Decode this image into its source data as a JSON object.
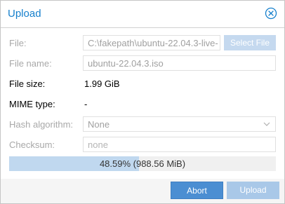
{
  "dialog": {
    "title": "Upload"
  },
  "form": {
    "file": {
      "label": "File:",
      "value": "C:\\fakepath\\ubuntu-22.04.3-live-",
      "button": "Select File"
    },
    "file_name": {
      "label": "File name:",
      "value": "ubuntu-22.04.3.iso"
    },
    "file_size": {
      "label": "File size:",
      "value": "1.99 GiB"
    },
    "mime_type": {
      "label": "MIME type:",
      "value": "-"
    },
    "hash_algorithm": {
      "label": "Hash algorithm:",
      "value": "None"
    },
    "checksum": {
      "label": "Checksum:",
      "placeholder": "none"
    }
  },
  "progress": {
    "fraction": 0.4859,
    "text": "48.59% (988.56 MiB)"
  },
  "buttons": {
    "abort": "Abort",
    "upload": "Upload"
  },
  "icons": {
    "close": "close-circle-icon",
    "dropdown": "chevron-down-icon"
  },
  "colors": {
    "accent": "#157fcc",
    "primary_button": "#4b8ed2",
    "disabled_button": "#a9c8e8",
    "progress_fill": "#c0d8ef"
  }
}
